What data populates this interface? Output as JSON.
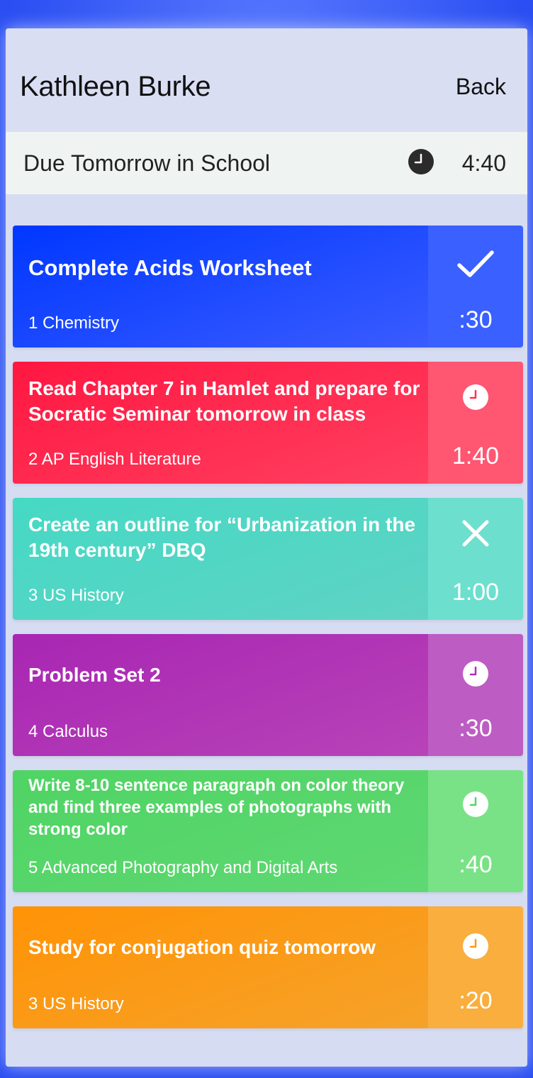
{
  "header": {
    "user_name": "Kathleen Burke",
    "back_label": "Back"
  },
  "due_bar": {
    "title": "Due Tomorrow in School",
    "clock_icon": "clock-icon",
    "time": "4:40"
  },
  "tasks": [
    {
      "title": "Complete Acids Worksheet",
      "subject": "1 Chemistry",
      "duration": ":30",
      "status_icon": "checkmark-icon",
      "color": "#0640ff"
    },
    {
      "title": "Read Chapter 7 in Hamlet and prepare for Socratic Seminar tomorrow in class",
      "subject": "2 AP English Literature",
      "duration": "1:40",
      "status_icon": "clock-icon",
      "color": "#ff1f4b"
    },
    {
      "title": "Create an outline for  “Urbanization in the 19th century” DBQ",
      "subject": "3 US History",
      "duration": "1:00",
      "status_icon": "close-icon",
      "color": "#44d6c0"
    },
    {
      "title": "Problem Set 2",
      "subject": "4 Calculus",
      "duration": ":30",
      "status_icon": "clock-icon",
      "color": "#ac2db5"
    },
    {
      "title": "Write 8-10 sentence paragraph on color theory and find three examples of photographs with strong color",
      "subject": "5 Advanced Photography and Digital Arts",
      "duration": ":40",
      "status_icon": "clock-icon",
      "color": "#52d466"
    },
    {
      "title": "Study for conjugation quiz tomorrow",
      "subject": "3 US History",
      "duration": ":20",
      "status_icon": "clock-icon",
      "color": "#ff9710"
    }
  ]
}
